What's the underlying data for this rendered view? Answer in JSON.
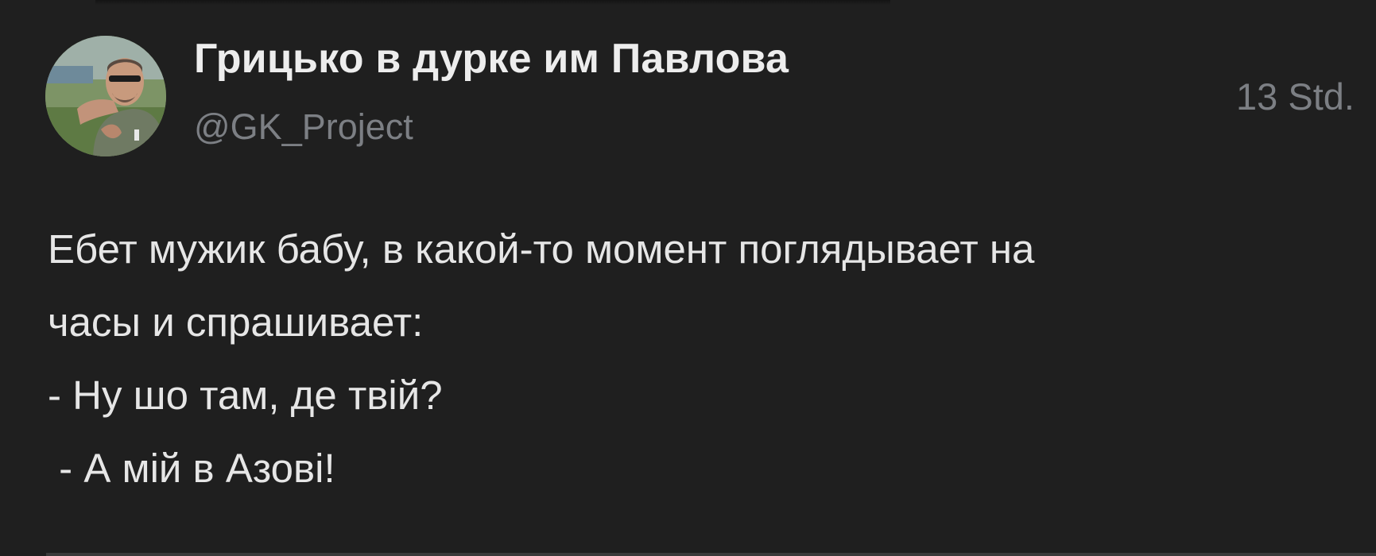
{
  "tweet": {
    "author": {
      "display_name": "Грицько в дурке им Павлова",
      "handle": "@GK_Project"
    },
    "timestamp": "13 Std.",
    "text_lines": [
      "Ебет мужик бабу, в какой-то момент поглядывает на",
      "часы и спрашивает:",
      "- Ну шо там, де твій?",
      " - А мій в Азові!"
    ]
  }
}
